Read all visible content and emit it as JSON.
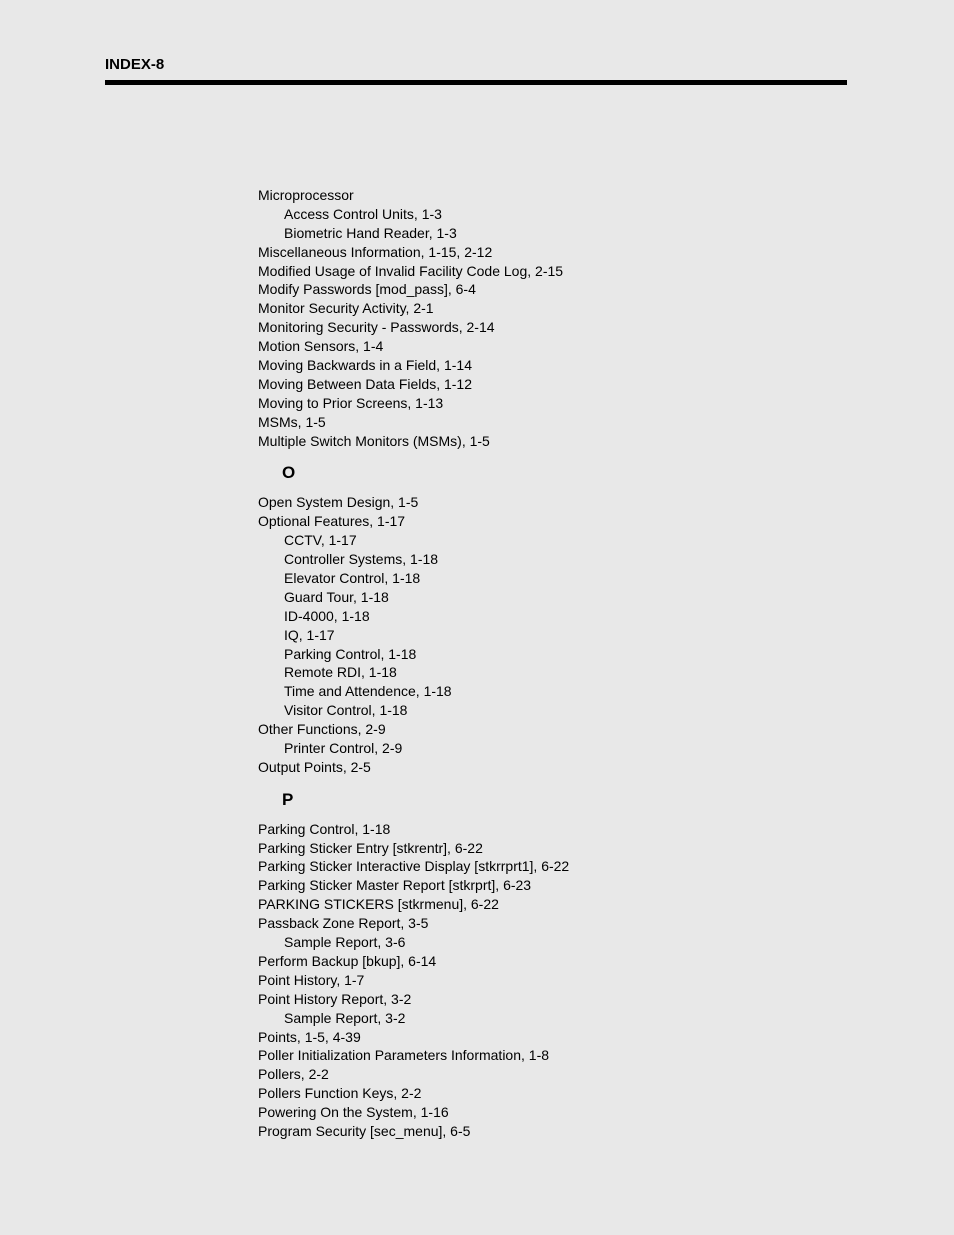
{
  "header": "INDEX-8",
  "sections": [
    {
      "heading": null,
      "entries": [
        {
          "text": "Microprocessor",
          "sub": false
        },
        {
          "text": "Access Control Units,  1-3",
          "sub": true
        },
        {
          "text": "Biometric Hand Reader,  1-3",
          "sub": true
        },
        {
          "text": "Miscellaneous Information,  1-15,  2-12",
          "sub": false
        },
        {
          "text": "Modified Usage of Invalid Facility Code Log,  2-15",
          "sub": false
        },
        {
          "text": "Modify Passwords [mod_pass],  6-4",
          "sub": false
        },
        {
          "text": "Monitor Security Activity,  2-1",
          "sub": false
        },
        {
          "text": "Monitoring Security - Passwords,  2-14",
          "sub": false
        },
        {
          "text": "Motion Sensors,  1-4",
          "sub": false
        },
        {
          "text": "Moving Backwards in a Field,  1-14",
          "sub": false
        },
        {
          "text": "Moving Between Data Fields,  1-12",
          "sub": false
        },
        {
          "text": "Moving to Prior Screens,  1-13",
          "sub": false
        },
        {
          "text": "MSMs,  1-5",
          "sub": false
        },
        {
          "text": "Multiple Switch Monitors (MSMs),  1-5",
          "sub": false
        }
      ]
    },
    {
      "heading": "O",
      "entries": [
        {
          "text": "Open System Design,  1-5",
          "sub": false
        },
        {
          "text": "Optional Features,  1-17",
          "sub": false
        },
        {
          "text": "CCTV,  1-17",
          "sub": true
        },
        {
          "text": "Controller Systems,  1-18",
          "sub": true
        },
        {
          "text": "Elevator Control,  1-18",
          "sub": true
        },
        {
          "text": "Guard Tour,  1-18",
          "sub": true
        },
        {
          "text": "ID-4000,  1-18",
          "sub": true
        },
        {
          "text": "IQ,  1-17",
          "sub": true
        },
        {
          "text": "Parking Control,  1-18",
          "sub": true
        },
        {
          "text": "Remote RDI,  1-18",
          "sub": true
        },
        {
          "text": "Time and Attendence,  1-18",
          "sub": true
        },
        {
          "text": "Visitor Control,  1-18",
          "sub": true
        },
        {
          "text": "Other Functions,  2-9",
          "sub": false
        },
        {
          "text": "Printer Control,  2-9",
          "sub": true
        },
        {
          "text": "Output Points,  2-5",
          "sub": false
        }
      ]
    },
    {
      "heading": "P",
      "entries": [
        {
          "text": "Parking Control,  1-18",
          "sub": false
        },
        {
          "text": "Parking Sticker Entry [stkrentr],  6-22",
          "sub": false
        },
        {
          "text": "Parking Sticker Interactive Display [stkrrprt1],  6-22",
          "sub": false
        },
        {
          "text": "Parking Sticker Master Report [stkrprt],  6-23",
          "sub": false
        },
        {
          "text": "PARKING STICKERS [stkrmenu],  6-22",
          "sub": false
        },
        {
          "text": "Passback Zone Report,  3-5",
          "sub": false
        },
        {
          "text": "Sample Report,  3-6",
          "sub": true
        },
        {
          "text": "Perform Backup [bkup],  6-14",
          "sub": false
        },
        {
          "text": "Point History,  1-7",
          "sub": false
        },
        {
          "text": "Point History Report,  3-2",
          "sub": false
        },
        {
          "text": "Sample Report,  3-2",
          "sub": true
        },
        {
          "text": "Points,  1-5,  4-39",
          "sub": false
        },
        {
          "text": "Poller Initialization Parameters Information,  1-8",
          "sub": false
        },
        {
          "text": "Pollers,  2-2",
          "sub": false
        },
        {
          "text": "Pollers Function Keys,  2-2",
          "sub": false
        },
        {
          "text": "Powering On the System,  1-16",
          "sub": false
        },
        {
          "text": "Program Security [sec_menu],  6-5",
          "sub": false
        }
      ]
    }
  ]
}
